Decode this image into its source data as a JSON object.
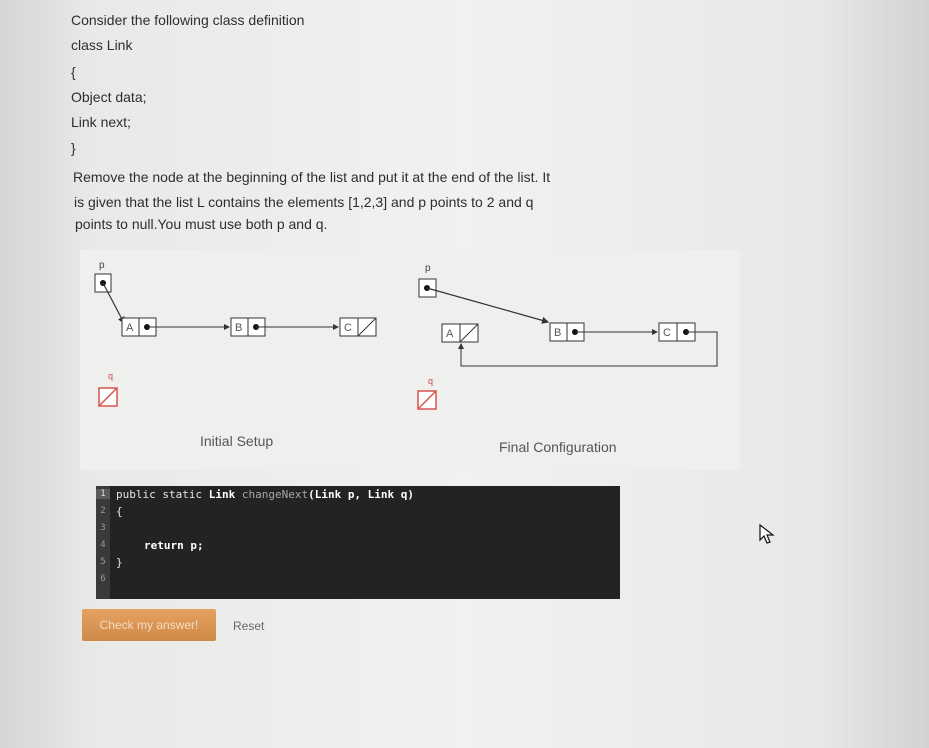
{
  "question": {
    "lines": [
      "Consider the following class definition",
      "class Link",
      "{",
      "Object data;",
      "Link next;",
      "}",
      "Remove the node at the beginning of the list and put it at the end of the list. It",
      "is given that the list L contains the elements [1,2,3] and p points to 2 and q",
      "points to null.You must use both p and q."
    ]
  },
  "diagram": {
    "initial_caption": "Initial Setup",
    "final_caption": "Final Configuration",
    "pointer_p": "p",
    "pointer_q": "q",
    "nodes": [
      "A",
      "B",
      "C"
    ]
  },
  "editor": {
    "line_numbers": [
      "1",
      "2",
      "3",
      "4",
      "5",
      "6"
    ],
    "line1_kw": "public static ",
    "line1_type": "Link ",
    "line1_fn": "changeNext",
    "line1_params": "(Link p, Link q)",
    "line2": "{",
    "line4": "return p;",
    "line5": "}"
  },
  "buttons": {
    "check": "Check my answer!",
    "reset": "Reset"
  },
  "colors": {
    "check_button": "#d99250",
    "editor_bg": "#232323",
    "null_marker": "#d9534f"
  }
}
